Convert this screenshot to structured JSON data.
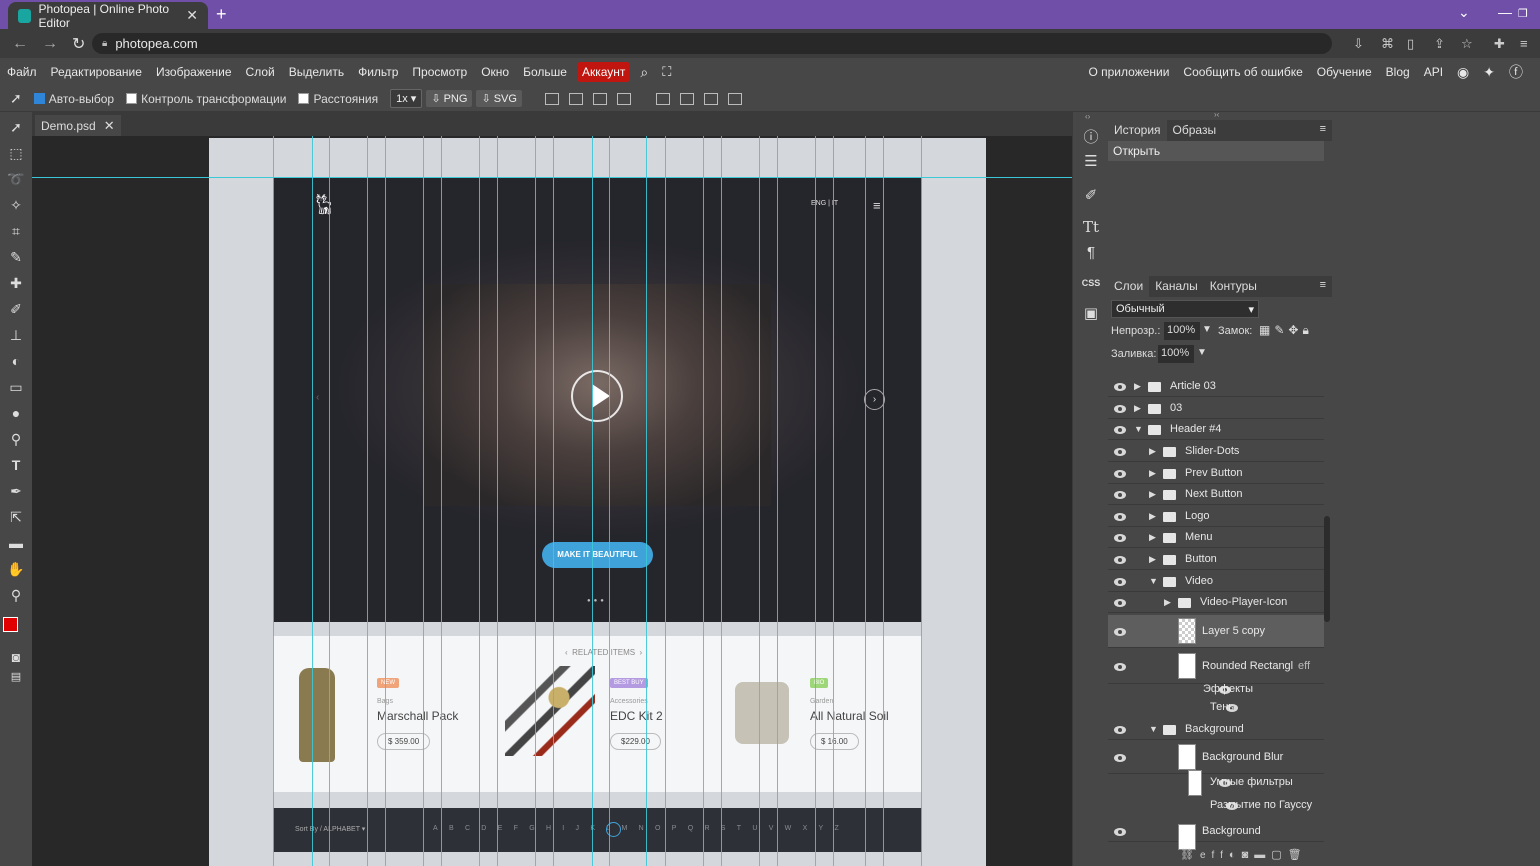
{
  "browser": {
    "tab_title": "Photopea | Online Photo Editor",
    "tab_close": "✕",
    "new_tab": "+",
    "url": "photopea.com"
  },
  "menu": {
    "items": [
      "Файл",
      "Редактирование",
      "Изображение",
      "Слой",
      "Выделить",
      "Фильтр",
      "Просмотр",
      "Окно",
      "Больше"
    ],
    "account": "Аккаунт",
    "right_items": [
      "О приложении",
      "Сообщить об ошибке",
      "Обучение",
      "Blog",
      "API"
    ]
  },
  "options": {
    "auto_select": "Авто-выбор",
    "transform_controls": "Контроль трансформации",
    "distances": "Расстояния",
    "scale": "1x",
    "png": "PNG",
    "svg": "SVG"
  },
  "document": {
    "tab": "Demo.psd",
    "close": "✕"
  },
  "design": {
    "hero_nav": "ENG   |   IT",
    "cta": "MAKE IT BEAUTIFUL",
    "related_title": "RELATED ITEMS",
    "products": [
      {
        "tag": "NEW",
        "tag_color": "#f0a47a",
        "category": "Bags",
        "name": "Marschall Pack",
        "price": "$ 359.00"
      },
      {
        "tag": "BEST BUY",
        "tag_color": "#b49ae0",
        "category": "Accessories",
        "name": "EDC Kit 2",
        "price": "$229.00"
      },
      {
        "tag": "BIO",
        "tag_color": "#9ed67a",
        "category": "Garden",
        "name": "All Natural Soil",
        "price": "$ 16.00"
      }
    ],
    "sort_label": "Sort By / ALPHABET",
    "letters": "ABCDEFGHIJKLMNOPQRSTUVWXYZ"
  },
  "history_panel": {
    "tabs": [
      "История",
      "Образы"
    ],
    "items": [
      "Открыть"
    ]
  },
  "layers_panel": {
    "tabs": [
      "Слои",
      "Каналы",
      "Контуры"
    ],
    "blend_mode": "Обычный",
    "opacity_label": "Непрозр.:",
    "opacity": "100%",
    "lock_label": "Замок:",
    "fill_label": "Заливка:",
    "fill": "100%",
    "layers": [
      {
        "name": "Article 03",
        "indent": 0,
        "type": "folder",
        "open": false
      },
      {
        "name": "03",
        "indent": 0,
        "type": "folder",
        "open": false
      },
      {
        "name": "Header #4",
        "indent": 0,
        "type": "folder",
        "open": true
      },
      {
        "name": "Slider-Dots",
        "indent": 1,
        "type": "folder",
        "open": false
      },
      {
        "name": "Prev Button",
        "indent": 1,
        "type": "folder",
        "open": false
      },
      {
        "name": "Next Button",
        "indent": 1,
        "type": "folder",
        "open": false
      },
      {
        "name": "Logo",
        "indent": 1,
        "type": "folder",
        "open": false
      },
      {
        "name": "Menu",
        "indent": 1,
        "type": "folder",
        "open": false
      },
      {
        "name": "Button",
        "indent": 1,
        "type": "folder",
        "open": false
      },
      {
        "name": "Video",
        "indent": 1,
        "type": "folder",
        "open": true
      },
      {
        "name": "Video-Player-Icon",
        "indent": 2,
        "type": "folder",
        "open": false
      },
      {
        "name": "Layer 5 copy",
        "indent": 2,
        "type": "layer",
        "selected": true
      },
      {
        "name": "Rounded Rectangl",
        "indent": 2,
        "type": "layer",
        "fx": "eff"
      },
      {
        "name": "Эффекты",
        "indent": 3,
        "type": "effect"
      },
      {
        "name": "Тень",
        "indent": 4,
        "type": "effect"
      },
      {
        "name": "Background",
        "indent": 1,
        "type": "folder",
        "open": true
      },
      {
        "name": "Background Blur",
        "indent": 2,
        "type": "layer"
      },
      {
        "name": "Умные фильтры",
        "indent": 3,
        "type": "smart"
      },
      {
        "name": "Размытие по Гауссу",
        "indent": 4,
        "type": "effect"
      },
      {
        "name": "Background",
        "indent": 2,
        "type": "layer"
      }
    ],
    "bottom_icons": [
      "link-icon",
      "fx-icon",
      "adjust-icon",
      "mask-icon",
      "folder-icon",
      "new-layer-icon",
      "trash-icon"
    ]
  },
  "colors": {
    "foreground": "#e00000",
    "background": "#000000",
    "guide": "#3cc8d6",
    "accent": "#3fa3da"
  }
}
